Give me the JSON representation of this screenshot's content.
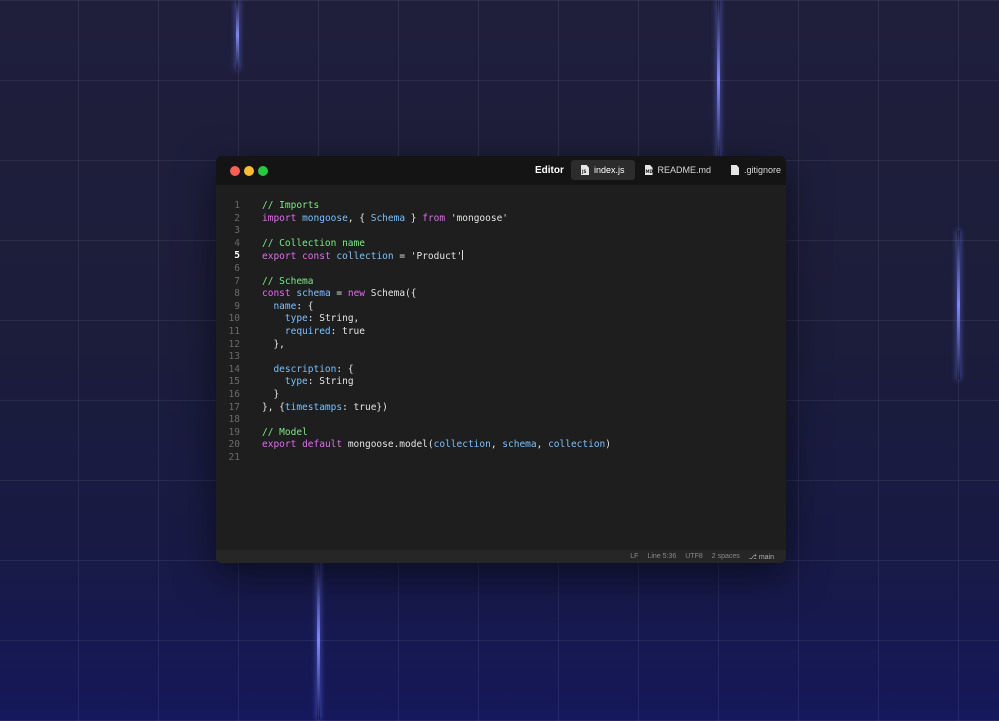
{
  "window": {
    "title": "Editor",
    "traffic_lights": [
      "close",
      "minimize",
      "maximize"
    ]
  },
  "tabs": [
    {
      "label": "index.js",
      "icon": "js-file-icon",
      "active": true
    },
    {
      "label": "README.md",
      "icon": "md-file-icon",
      "active": false
    },
    {
      "label": ".gitignore",
      "icon": "file-icon",
      "active": false
    }
  ],
  "editor": {
    "current_line": 5,
    "lines": [
      {
        "n": "1",
        "tokens": [
          {
            "t": "// Imports",
            "c": "comment"
          }
        ]
      },
      {
        "n": "2",
        "tokens": [
          {
            "t": "import",
            "c": "keyword"
          },
          {
            "t": " ",
            "c": "plain"
          },
          {
            "t": "mongoose",
            "c": "ident"
          },
          {
            "t": ", { ",
            "c": "plain"
          },
          {
            "t": "Schema",
            "c": "ident"
          },
          {
            "t": " } ",
            "c": "plain"
          },
          {
            "t": "from",
            "c": "keyword"
          },
          {
            "t": " 'mongoose'",
            "c": "string"
          }
        ]
      },
      {
        "n": "3",
        "tokens": []
      },
      {
        "n": "4",
        "tokens": [
          {
            "t": "// Collection name",
            "c": "comment"
          }
        ]
      },
      {
        "n": "5",
        "tokens": [
          {
            "t": "export",
            "c": "keyword"
          },
          {
            "t": " ",
            "c": "plain"
          },
          {
            "t": "const",
            "c": "keyword"
          },
          {
            "t": " ",
            "c": "plain"
          },
          {
            "t": "collection",
            "c": "ident"
          },
          {
            "t": " = 'Product'",
            "c": "string"
          }
        ]
      },
      {
        "n": "6",
        "tokens": []
      },
      {
        "n": "7",
        "tokens": [
          {
            "t": "// Schema",
            "c": "comment"
          }
        ]
      },
      {
        "n": "8",
        "tokens": [
          {
            "t": "const",
            "c": "keyword"
          },
          {
            "t": " ",
            "c": "plain"
          },
          {
            "t": "schema",
            "c": "ident"
          },
          {
            "t": " = ",
            "c": "plain"
          },
          {
            "t": "new",
            "c": "keyword"
          },
          {
            "t": " Schema({",
            "c": "plain"
          }
        ]
      },
      {
        "n": "9",
        "tokens": [
          {
            "t": "  ",
            "c": "plain"
          },
          {
            "t": "name",
            "c": "prop"
          },
          {
            "t": ": {",
            "c": "plain"
          }
        ]
      },
      {
        "n": "10",
        "tokens": [
          {
            "t": "    ",
            "c": "plain"
          },
          {
            "t": "type",
            "c": "prop"
          },
          {
            "t": ": String,",
            "c": "plain"
          }
        ]
      },
      {
        "n": "11",
        "tokens": [
          {
            "t": "    ",
            "c": "plain"
          },
          {
            "t": "required",
            "c": "prop"
          },
          {
            "t": ": true",
            "c": "plain"
          }
        ]
      },
      {
        "n": "12",
        "tokens": [
          {
            "t": "  },",
            "c": "plain"
          }
        ]
      },
      {
        "n": "13",
        "tokens": []
      },
      {
        "n": "14",
        "tokens": [
          {
            "t": "  ",
            "c": "plain"
          },
          {
            "t": "description",
            "c": "prop"
          },
          {
            "t": ": {",
            "c": "plain"
          }
        ]
      },
      {
        "n": "15",
        "tokens": [
          {
            "t": "    ",
            "c": "plain"
          },
          {
            "t": "type",
            "c": "prop"
          },
          {
            "t": ": String",
            "c": "plain"
          }
        ]
      },
      {
        "n": "16",
        "tokens": [
          {
            "t": "  }",
            "c": "plain"
          }
        ]
      },
      {
        "n": "17",
        "tokens": [
          {
            "t": "}, {",
            "c": "plain"
          },
          {
            "t": "timestamps",
            "c": "prop"
          },
          {
            "t": ": true})",
            "c": "plain"
          }
        ]
      },
      {
        "n": "18",
        "tokens": []
      },
      {
        "n": "19",
        "tokens": [
          {
            "t": "// Model",
            "c": "comment"
          }
        ]
      },
      {
        "n": "20",
        "tokens": [
          {
            "t": "export",
            "c": "keyword"
          },
          {
            "t": " ",
            "c": "plain"
          },
          {
            "t": "default",
            "c": "keyword"
          },
          {
            "t": " mongoose.model(",
            "c": "plain"
          },
          {
            "t": "collection",
            "c": "ident"
          },
          {
            "t": ", ",
            "c": "plain"
          },
          {
            "t": "schema",
            "c": "ident"
          },
          {
            "t": ", ",
            "c": "plain"
          },
          {
            "t": "collection",
            "c": "ident"
          },
          {
            "t": ")",
            "c": "plain"
          }
        ]
      },
      {
        "n": "21",
        "tokens": []
      }
    ]
  },
  "statusbar": {
    "line_ending": "LF",
    "position": "Line 5:36",
    "encoding": "UTF8",
    "indent": "2 spaces",
    "branch": "main"
  },
  "colors": {
    "comment": "#7ee787",
    "keyword": "#e06cf0",
    "identifier": "#79c0ff",
    "text": "#e4e4e4",
    "accent_beam": "#8c96ff"
  }
}
